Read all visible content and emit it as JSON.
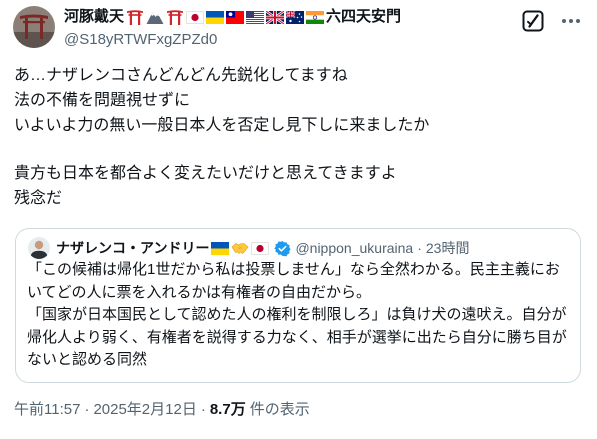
{
  "author": {
    "display_name": "河豚戴天",
    "name_icons": [
      "torii-icon",
      "snow-mountain-icon",
      "torii-icon",
      "flag-japan-icon",
      "flag-ukraine-icon",
      "flag-taiwan-icon",
      "flag-usa-icon",
      "flag-uk-icon",
      "flag-australia-icon",
      "flag-india-icon"
    ],
    "name_suffix": "六四天安門",
    "handle": "@S18yRTWFxgZPZd0"
  },
  "tweet": {
    "paragraphs": [
      [
        "あ…ナザレンコさんどんどん先鋭化してますね",
        "法の不備を問題視せずに",
        "いよいよ力の無い一般日本人を否定し見下しに来ましたか"
      ],
      [
        "貴方も日本を都合よく変えたいだけと思えてきますよ",
        "残念だ"
      ]
    ]
  },
  "quote": {
    "display_name": "ナザレンコ・アンドリー",
    "name_icons": [
      "flag-ukraine-icon",
      "handshake-icon",
      "flag-japan-icon"
    ],
    "handle": "@nippon_ukuraina",
    "sep": "·",
    "time": "23時間",
    "paragraphs": [
      "「この候補は帰化1世だから私は投票しません」なら全然わかる。民主主義においてどの人に票を入れるかは有権者の自由だから。",
      "「国家が日本国民として認めた人の権利を制限しろ」は負け犬の遠吠え。自分が帰化人より弱く、有権者を説得する力なく、相手が選挙に出たら自分に勝ち目がないと認める同然"
    ]
  },
  "meta": {
    "time": "午前11:57",
    "sep": "·",
    "date": "2025年2月12日",
    "views": "8.7万",
    "views_label": "件の表示"
  },
  "colors": {
    "text": "#0f1419",
    "muted": "#536471",
    "border": "#cfd9de",
    "verified": "#1d9bf0"
  }
}
